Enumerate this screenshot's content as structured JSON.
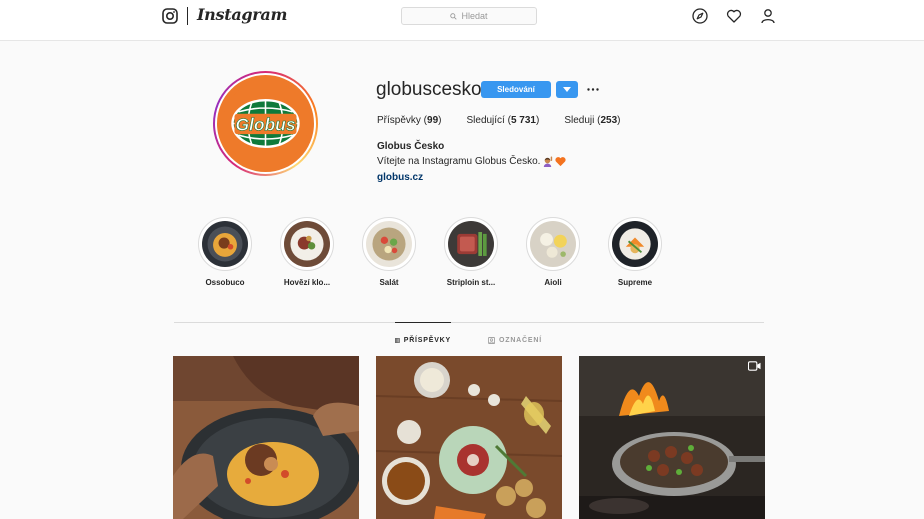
{
  "nav": {
    "wordmark": "Instagram",
    "search_placeholder": "Hledat",
    "icons": [
      "instagram-glyph-icon",
      "explore-compass-icon",
      "activity-heart-icon",
      "profile-person-icon"
    ]
  },
  "profile": {
    "username": "globuscesko",
    "follow_label": "Sledování",
    "more_label": "···",
    "stats": [
      {
        "label": "Příspěvky",
        "value": "99"
      },
      {
        "label": "Sledující",
        "value": "5 731"
      },
      {
        "label": "Sleduji",
        "value": "253"
      }
    ],
    "full_name": "Globus Česko",
    "bio": "Vítejte na Instagramu Globus Česko.",
    "bio_emojis": [
      "woman-raising-hand-emoji",
      "orange-heart-emoji"
    ],
    "website": "globus.cz",
    "avatar_text": "Globus",
    "colors": {
      "brand_orange": "#ee7a2a",
      "brand_green": "#0f7a3b",
      "follow_blue": "#3897f0",
      "link": "#003569"
    }
  },
  "highlights": [
    {
      "label": "Ossobuco"
    },
    {
      "label": "Hovězí klo..."
    },
    {
      "label": "Salát"
    },
    {
      "label": "Striploin st..."
    },
    {
      "label": "Aioli"
    },
    {
      "label": "Supreme"
    }
  ],
  "tabs": [
    {
      "label": "PŘÍSPĚVKY",
      "active": true,
      "icon": "grid-icon"
    },
    {
      "label": "OZNAČENÍ",
      "active": false,
      "icon": "tagged-icon"
    }
  ],
  "posts": [
    {
      "name": "ossobuco-plate-photo",
      "is_video": false
    },
    {
      "name": "raw-ingredients-flatlay-photo",
      "is_video": false
    },
    {
      "name": "campfire-pan-photo",
      "is_video": true
    }
  ]
}
